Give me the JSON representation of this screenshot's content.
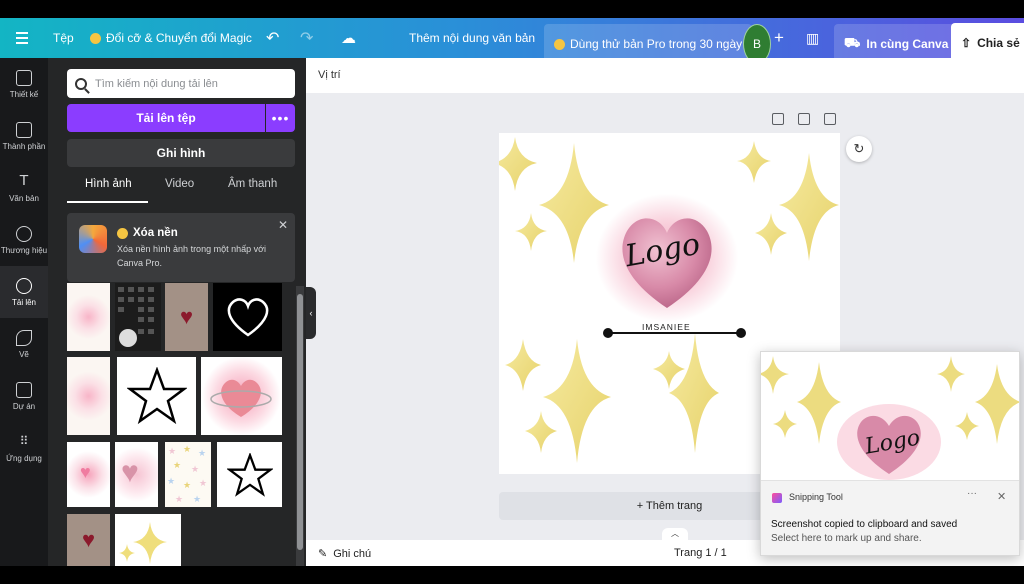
{
  "topbar": {
    "file": "Tệp",
    "magic": "Đổi cỡ & Chuyển đổi Magic",
    "doc_title": "Thêm nội dung văn bản",
    "pro_trial": "Dùng thử bản Pro trong 30 ngày",
    "avatar_letter": "B",
    "print": "In cùng Canva",
    "share": "Chia sẻ"
  },
  "sidebar": {
    "items": [
      {
        "label": "Thiết kế",
        "icon": "layout-icon"
      },
      {
        "label": "Thành phần",
        "icon": "elements-icon"
      },
      {
        "label": "Văn bản",
        "icon": "text-icon"
      },
      {
        "label": "Thương hiệu",
        "icon": "brand-icon"
      },
      {
        "label": "Tải lên",
        "icon": "upload-cloud-icon"
      },
      {
        "label": "Vẽ",
        "icon": "draw-icon"
      },
      {
        "label": "Dự án",
        "icon": "folder-icon"
      },
      {
        "label": "Ứng dụng",
        "icon": "apps-grid-icon"
      }
    ],
    "active_index": 4
  },
  "panel": {
    "search_placeholder": "Tìm kiếm nội dung tải lên",
    "upload_button": "Tải lên tệp",
    "record_button": "Ghi hình",
    "tabs": [
      "Hình ảnh",
      "Video",
      "Âm thanh"
    ],
    "active_tab": 0,
    "promo": {
      "title": "Xóa nền",
      "text": "Xóa nền hình ảnh trong một nhấp với Canva Pro."
    }
  },
  "editor": {
    "position_label": "Vị trí",
    "logo_text": "Logo",
    "name_text": "IMSANIEE",
    "add_page": "+ Thêm trang",
    "notes": "Ghi chú",
    "page_indicator": "Trang 1 / 1"
  },
  "snipping": {
    "app_name": "Snipping Tool",
    "title": "Screenshot copied to clipboard and saved",
    "text": "Select here to mark up and share.",
    "preview_logo": "Logo"
  },
  "colors": {
    "accent_purple": "#8b3dff",
    "topbar_start": "#13b5c4",
    "topbar_end": "#5b4de0",
    "sparkle_yellow": "#efde7c",
    "heart_pink": "#d88aa8"
  }
}
